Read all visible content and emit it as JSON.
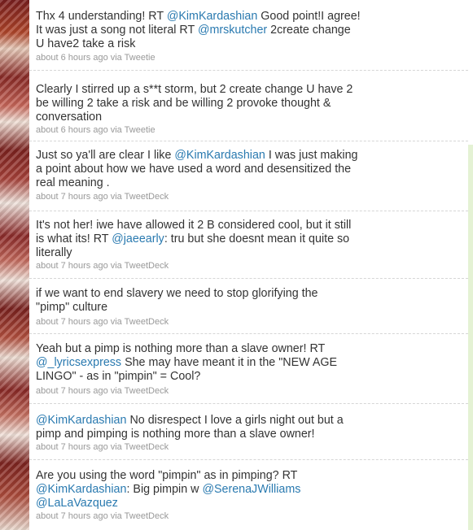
{
  "timeline": {
    "tweets": [
      {
        "lines": [
          [
            {
              "t": "Thx 4 understanding! RT "
            },
            {
              "m": "@KimKardashian"
            },
            {
              "t": " Good point!I agree!"
            }
          ],
          [
            {
              "t": "It was just a song not literal RT "
            },
            {
              "m": "@mrskutcher"
            },
            {
              "t": " 2create change"
            }
          ],
          [
            {
              "t": "U have2 take a risk"
            }
          ]
        ],
        "meta": "about 6 hours ago via Tweetie"
      },
      {
        "lines": [
          [
            {
              "t": "Clearly I stirred up a s**t storm, but 2 create change U have 2"
            }
          ],
          [
            {
              "t": "be willing 2 take a risk and be willing 2 provoke thought &"
            }
          ],
          [
            {
              "t": "conversation"
            }
          ]
        ],
        "meta": "about 6 hours ago via Tweetie"
      },
      {
        "lines": [
          [
            {
              "t": "Just so ya'll are clear I like "
            },
            {
              "m": "@KimKardashian"
            },
            {
              "t": " I was just making"
            }
          ],
          [
            {
              "t": "a point about how we have used a word and desensitized the"
            }
          ],
          [
            {
              "t": "real meaning ."
            }
          ]
        ],
        "meta": "about 7 hours ago via TweetDeck"
      },
      {
        "lines": [
          [
            {
              "t": "It's not her! iwe have allowed it 2 B considered cool, but it still"
            }
          ],
          [
            {
              "t": "is what its! RT "
            },
            {
              "m": "@jaeearly"
            },
            {
              "t": ": tru but she doesnt mean it quite so"
            }
          ],
          [
            {
              "t": "literally"
            }
          ]
        ],
        "meta": "about 7 hours ago via TweetDeck"
      },
      {
        "lines": [
          [
            {
              "t": "if we want to end slavery we need to stop glorifying the"
            }
          ],
          [
            {
              "t": "\"pimp\" culture"
            }
          ]
        ],
        "meta": "about 7 hours ago via TweetDeck"
      },
      {
        "lines": [
          [
            {
              "t": "Yeah but a pimp is nothing more than a slave owner! RT"
            }
          ],
          [
            {
              "m": "@_lyricsexpress"
            },
            {
              "t": " She may have meant it in the \"NEW AGE"
            }
          ],
          [
            {
              "t": "LINGO\" - as in \"pimpin\" = Cool?"
            }
          ]
        ],
        "meta": "about 7 hours ago via TweetDeck"
      },
      {
        "lines": [
          [
            {
              "m": "@KimKardashian"
            },
            {
              "t": " No disrespect I love a girls night out but a"
            }
          ],
          [
            {
              "t": "pimp and pimping is nothing more than a slave owner!"
            }
          ]
        ],
        "meta": "about 7 hours ago via TweetDeck"
      },
      {
        "lines": [
          [
            {
              "t": "Are you using the word \"pimpin\" as in pimping? RT"
            }
          ],
          [
            {
              "m": "@KimKardashian"
            },
            {
              "t": ": Big pimpin w "
            },
            {
              "m": "@SerenaJWilliams"
            }
          ],
          [
            {
              "m": "@LaLaVazquez"
            }
          ]
        ],
        "meta": "about 7 hours ago via TweetDeck"
      }
    ]
  },
  "colors": {
    "text": "#333333",
    "mention": "#2a7ab0",
    "meta": "#999999",
    "divider": "#d6d6d6"
  }
}
